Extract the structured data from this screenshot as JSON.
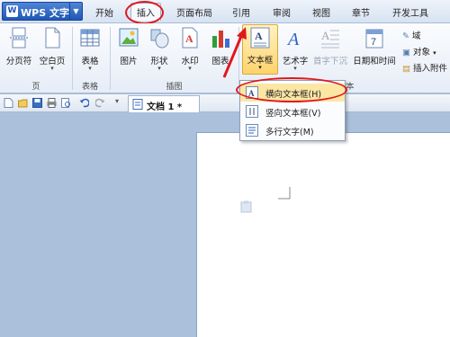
{
  "app": {
    "title": "WPS 文字",
    "logo": "W"
  },
  "tabs": [
    "开始",
    "插入",
    "页面布局",
    "引用",
    "审阅",
    "视图",
    "章节",
    "开发工具"
  ],
  "active_tab": "插入",
  "ribbon": {
    "page_group": {
      "label": "页",
      "buttons": [
        "分页符",
        "空白页"
      ]
    },
    "table_group": {
      "label": "表格",
      "buttons": [
        "表格"
      ]
    },
    "illus_group": {
      "label": "插图",
      "buttons": [
        "图片",
        "形状",
        "水印",
        "图表"
      ]
    },
    "text_group": {
      "buttons": [
        "文本框",
        "艺术字",
        "首字下沉",
        "日期和时间"
      ],
      "label_tail": "本"
    },
    "small_items": [
      "域",
      "对象",
      "插入附件"
    ]
  },
  "dropdown": {
    "items": [
      "横向文本框(H)",
      "竖向文本框(V)",
      "多行文字(M)"
    ]
  },
  "document": {
    "tab_title": "文档 1 *"
  },
  "colors": {
    "accent_red": "#e0181b",
    "highlight": "#ffd36b",
    "brand_blue": "#1f57b5"
  }
}
